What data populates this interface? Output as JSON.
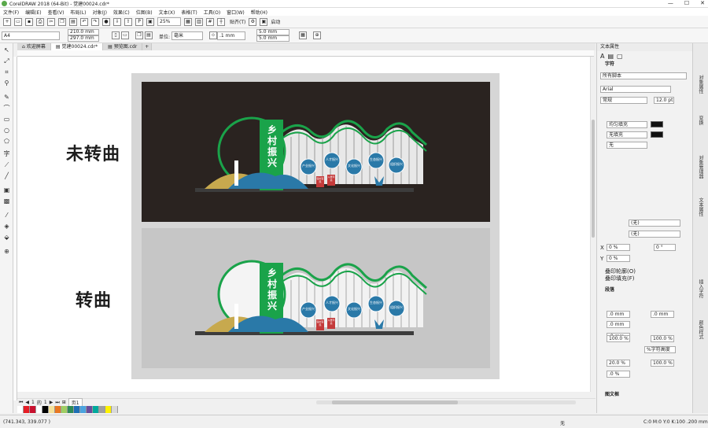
{
  "title_bar": {
    "app_title": "CorelDRAW 2018 (64-Bit) - 觉建00024.cdr*"
  },
  "menu": [
    "文件(F)",
    "编辑(E)",
    "查看(V)",
    "布局(L)",
    "对象(J)",
    "效果(C)",
    "位图(B)",
    "文本(X)",
    "表格(T)",
    "工具(O)",
    "窗口(W)",
    "帮助(H)"
  ],
  "toolbar": {
    "zoom": "25%",
    "snap_label": "贴齐(T)",
    "launch_label": "启动"
  },
  "property_bar": {
    "page_size": "A4",
    "width": "210.0 mm",
    "height": "297.0 mm",
    "units_label": "单位:",
    "units": "毫米",
    "nudge": ".1 mm",
    "dup_x": "5.0 mm",
    "dup_y": "5.0 mm"
  },
  "tabs": [
    {
      "label": "欢迎屏幕"
    },
    {
      "label": "觉建00024.cdr*"
    },
    {
      "label": "预览图.cdr"
    }
  ],
  "canvas": {
    "label_top": "未转曲",
    "label_bottom": "转曲",
    "sign_title_chars": [
      "乡",
      "村",
      "振",
      "兴"
    ],
    "circles": [
      "产业振兴",
      "人才振兴",
      "文化振兴",
      "生态振兴",
      "组织振兴"
    ],
    "boards": [
      "强村富民",
      "人居环境"
    ]
  },
  "page_nav": {
    "current": "1",
    "of": "的",
    "total": "1",
    "page_tab": "页1"
  },
  "status": {
    "coords": "(741.343, 339.077 )",
    "fill_none": "无",
    "outline": "C:0 M:0 Y:0 K:100  .200 mm"
  },
  "docker": {
    "header": "文本属性",
    "char_section": "字符",
    "script": "所有脚本",
    "font": "Arial",
    "style": "常规",
    "size": "12.0 pt",
    "fill_type": "均匀填充",
    "bg_fill": "无填充",
    "outline": "无",
    "none1": "(无)",
    "none2": "(无)",
    "x_offset": "0 %",
    "y_offset": "0 %",
    "angle": "0 °",
    "overline_label": "叠印轮廓(O)",
    "overfill_label": "叠印填充(F)",
    "para_section": "段落",
    "indent1": ".0 mm",
    "indent2": ".0 mm",
    "indent3": ".0 mm",
    "indent4": ".0 mm",
    "spacing1": "100.0 %",
    "spacing2": "100.0 %",
    "pct_char": "%字符高度",
    "spacing3": "20.0 %",
    "spacing4": "100.0 %",
    "spacing5": ".0 %",
    "frame_section": "图文框"
  },
  "side_tabs": [
    "对象属性",
    "变换",
    "对象管理器",
    "文本属性",
    "插入字符",
    "颜色样式"
  ],
  "colors": {
    "sign_green": "#1aa34a",
    "circle_blue": "#2a79a8",
    "dark_panel": "#2a2320",
    "light_panel": "#c6c6c6",
    "board_red": "#c43a3a"
  }
}
